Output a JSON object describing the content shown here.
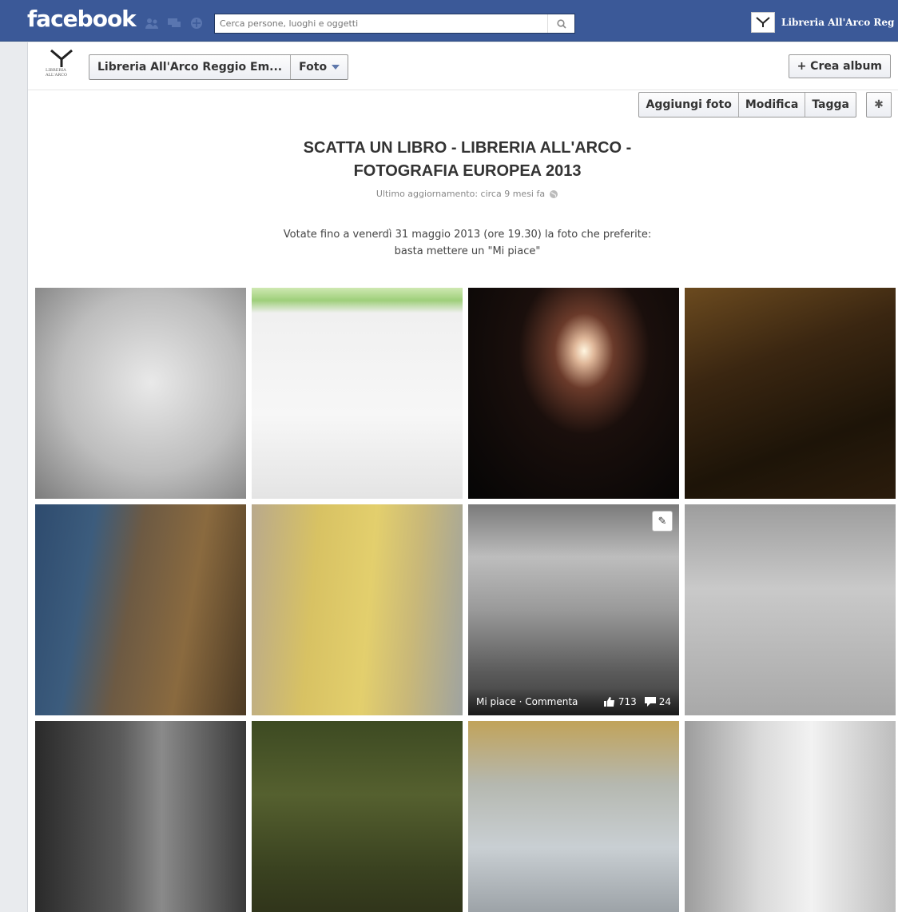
{
  "topbar": {
    "logo": "facebook",
    "search_placeholder": "Cerca persone, luoghi e oggetti",
    "page_name": "Libreria All'Arco Reg",
    "page_logo_text": "LIBRERIA ALL'ARCO"
  },
  "toolbar": {
    "page_logo_text": "LIBRERIA ALL'ARCO",
    "crumb_page": "Libreria All'Arco Reggio Em...",
    "crumb_section": "Foto",
    "create_album": "+ Crea album"
  },
  "actions": {
    "add_photo": "Aggiungi foto",
    "edit": "Modifica",
    "tag": "Tagga",
    "gear": "✱"
  },
  "album": {
    "title_line1": "SCATTA UN LIBRO - LIBRERIA ALL'ARCO -",
    "title_line2": "FOTOGRAFIA EUROPEA 2013",
    "updated": "Ultimo aggiornamento: circa 9 mesi fa",
    "description_line1": "Votate fino a venerdì 31 maggio 2013 (ore 19.30) la foto che preferite:",
    "description_line2": "basta mettere un \"Mi piace\""
  },
  "hover_photo": {
    "links": "Mi piace · Commenta",
    "likes": "713",
    "comments": "24"
  },
  "colors": {
    "brand": "#3b5998",
    "border": "#999999"
  },
  "icons": [
    "friends-icon",
    "messages-icon",
    "notifications-icon",
    "search-icon",
    "caret-down-icon",
    "gear-icon",
    "globe-icon",
    "pencil-icon",
    "like-icon",
    "comment-icon"
  ]
}
